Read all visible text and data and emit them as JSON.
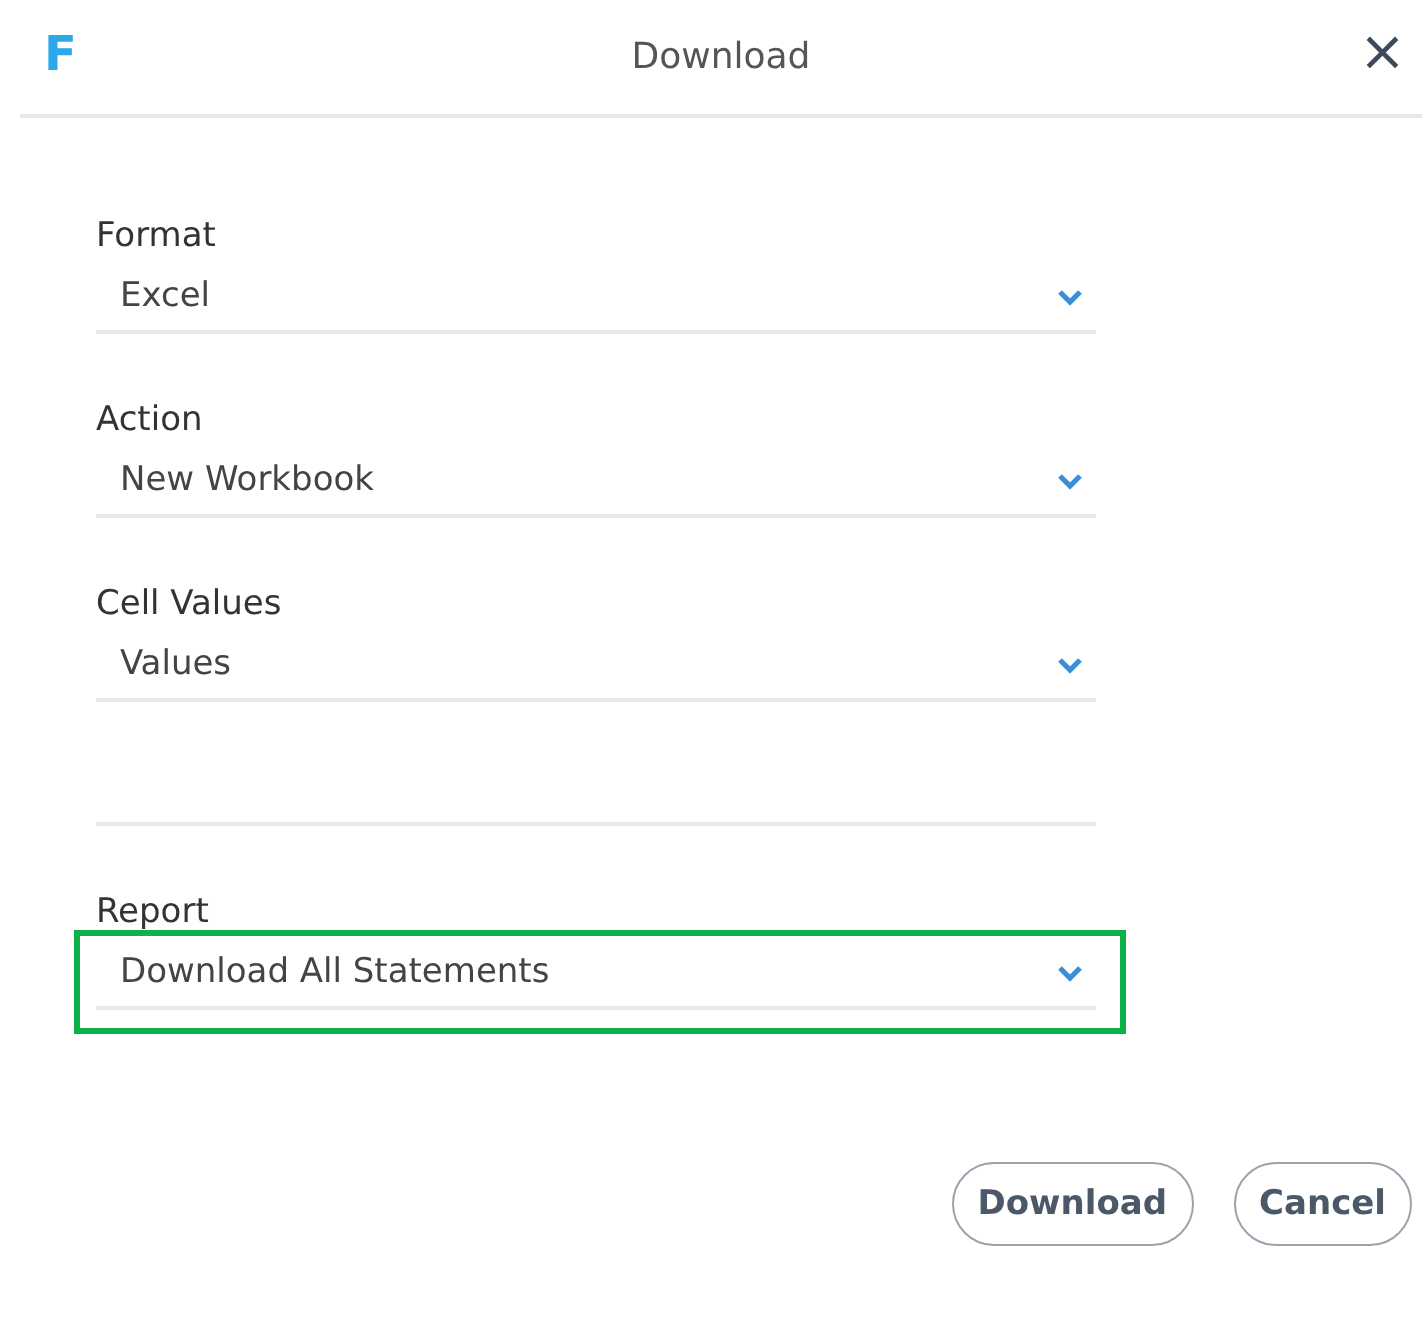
{
  "window": {
    "logo": "F",
    "title": "Download",
    "close": "×"
  },
  "fields": [
    {
      "kind": "select",
      "label": "Format",
      "value": "Excel",
      "highlighted": false
    },
    {
      "kind": "select",
      "label": "Action",
      "value": "New Workbook",
      "highlighted": false
    },
    {
      "kind": "select",
      "label": "Cell Values",
      "value": "Values",
      "highlighted": false
    },
    {
      "kind": "blank",
      "highlighted": false
    },
    {
      "kind": "select",
      "label": "Report",
      "value": "Download All Statements",
      "highlighted": true
    }
  ],
  "buttons": [
    "Download",
    "Cancel"
  ]
}
